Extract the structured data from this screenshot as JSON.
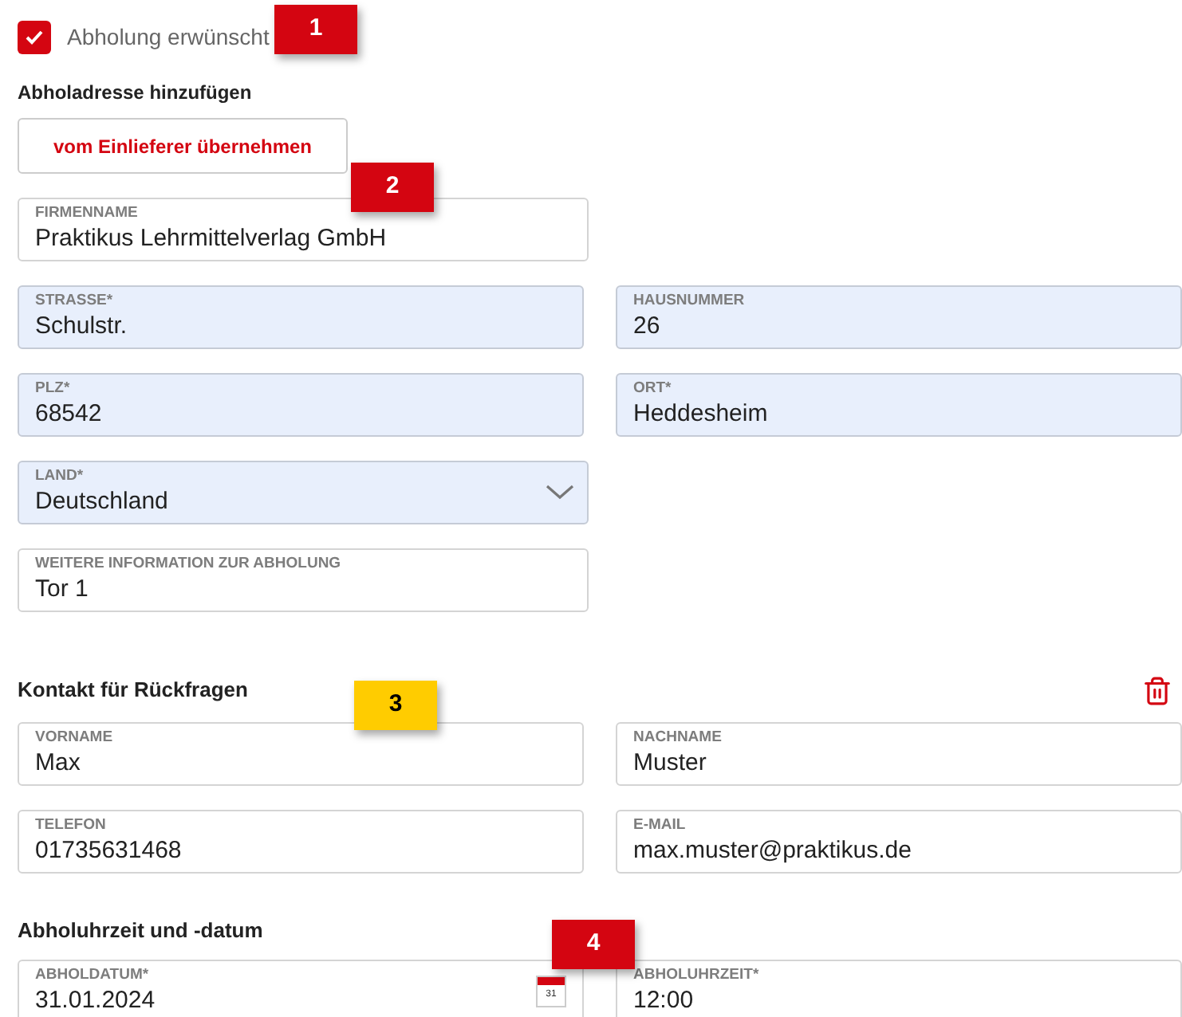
{
  "pickup_checkbox": {
    "label": "Abholung erwünscht",
    "checked": true
  },
  "address": {
    "heading": "Abholadresse hinzufügen",
    "copy_button": "vom Einlieferer übernehmen",
    "rows": [
      [
        {
          "kind": "text",
          "label": "FIRMENNAME",
          "value": "Praktikus Lehrmittelverlag GmbH",
          "highlighted": false
        }
      ],
      [
        {
          "kind": "text",
          "label": "STRASSE*",
          "value": "Schulstr.",
          "highlighted": true
        },
        {
          "kind": "text",
          "label": "HAUSNUMMER",
          "value": "26",
          "highlighted": true
        }
      ],
      [
        {
          "kind": "text",
          "label": "PLZ*",
          "value": "68542",
          "highlighted": true
        },
        {
          "kind": "text",
          "label": "ORT*",
          "value": "Heddesheim",
          "highlighted": true
        }
      ],
      [
        {
          "kind": "select",
          "label": "LAND*",
          "value": "Deutschland",
          "highlighted": true
        }
      ],
      [
        {
          "kind": "text",
          "label": "WEITERE INFORMATION ZUR ABHOLUNG",
          "value": "Tor 1",
          "highlighted": false
        }
      ]
    ]
  },
  "contact": {
    "heading": "Kontakt für Rückfragen",
    "rows": [
      [
        {
          "kind": "text",
          "label": "VORNAME",
          "value": "Max",
          "highlighted": false
        },
        {
          "kind": "text",
          "label": "NACHNAME",
          "value": "Muster",
          "highlighted": false
        }
      ],
      [
        {
          "kind": "text",
          "label": "TELEFON",
          "value": "01735631468",
          "highlighted": false
        },
        {
          "kind": "text",
          "label": "E-MAIL",
          "value": "max.muster@praktikus.de",
          "highlighted": false
        }
      ]
    ]
  },
  "schedule": {
    "heading": "Abholuhrzeit und -datum",
    "rows": [
      [
        {
          "kind": "date",
          "label": "ABHOLDATUM*",
          "value": "31.01.2024",
          "highlighted": false,
          "icon_text": "31"
        },
        {
          "kind": "text",
          "label": "ABHOLUHRZEIT*",
          "value": "12:00",
          "highlighted": false
        }
      ]
    ]
  },
  "badges": [
    {
      "label": "1",
      "color": "#d40511"
    },
    {
      "label": "2",
      "color": "#d40511"
    },
    {
      "label": "3",
      "color": "#ffcc00"
    },
    {
      "label": "4",
      "color": "#d40511"
    }
  ]
}
